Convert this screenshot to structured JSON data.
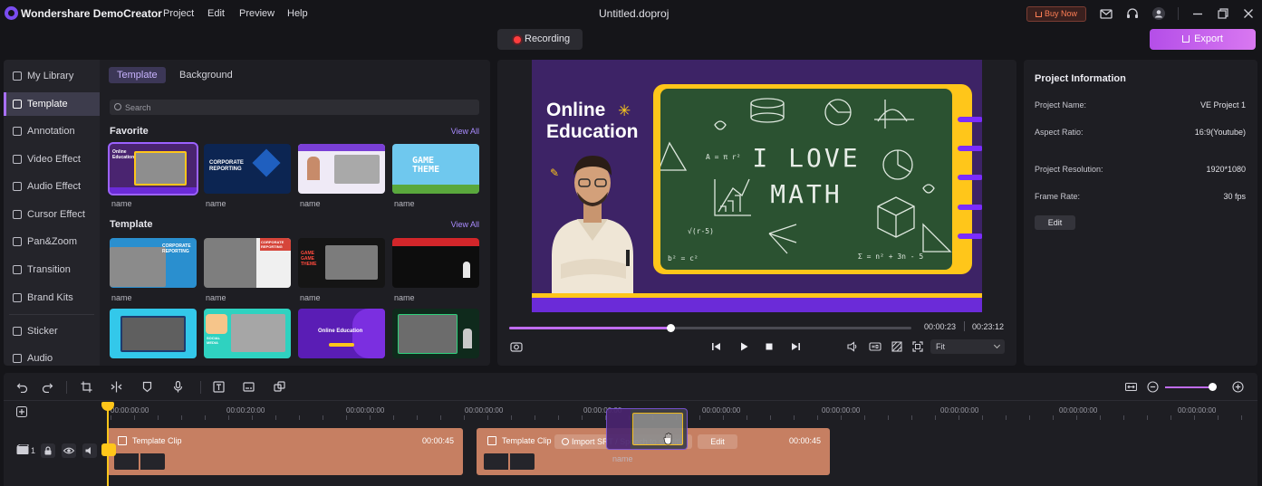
{
  "app": {
    "name": "Wondershare DemoCreator",
    "document_title": "Untitled.doproj",
    "menu": [
      "Project",
      "Edit",
      "Preview",
      "Help"
    ],
    "buy_now": "Buy Now",
    "recording": "Recording",
    "export": "Export"
  },
  "sidebar": {
    "items": [
      {
        "label": "My Library",
        "icon": "library-icon"
      },
      {
        "label": "Template",
        "icon": "template-icon",
        "active": true
      },
      {
        "label": "Annotation",
        "icon": "annotation-icon"
      },
      {
        "label": "Video Effect",
        "icon": "video-effect-icon"
      },
      {
        "label": "Audio Effect",
        "icon": "audio-effect-icon"
      },
      {
        "label": "Cursor Effect",
        "icon": "cursor-effect-icon"
      },
      {
        "label": "Pan&Zoom",
        "icon": "pan-zoom-icon"
      },
      {
        "label": "Transition",
        "icon": "transition-icon"
      },
      {
        "label": "Brand Kits",
        "icon": "brand-kits-icon"
      },
      {
        "label": "Sticker",
        "icon": "sticker-icon"
      },
      {
        "label": "Audio",
        "icon": "audio-icon"
      }
    ]
  },
  "library": {
    "tabs": [
      "Template",
      "Background"
    ],
    "search_placeholder": "Search",
    "favorite": {
      "title": "Favorite",
      "view_all": "View All",
      "items": [
        {
          "name": "name",
          "caption": "Online Education"
        },
        {
          "name": "name",
          "caption": "CORPORATE REPORTING"
        },
        {
          "name": "name",
          "caption": ""
        },
        {
          "name": "name",
          "caption": "GAME THEME"
        }
      ]
    },
    "template": {
      "title": "Template",
      "view_all": "View All",
      "items": [
        {
          "name": "name",
          "caption": "CORPORATE REPORTING"
        },
        {
          "name": "name",
          "caption": "CORPORATE REPORTING"
        },
        {
          "name": "name",
          "caption": "GAME GAME THEME"
        },
        {
          "name": "name",
          "caption": ""
        },
        {
          "name": "",
          "caption": ""
        },
        {
          "name": "",
          "caption": "SOCIAL MEDIA"
        },
        {
          "name": "",
          "caption": "Online Education"
        },
        {
          "name": "",
          "caption": ""
        }
      ]
    }
  },
  "preview": {
    "title_line1": "Online",
    "title_line2": "Education",
    "board_line1": "I LOVE",
    "board_line2": "MATH",
    "formula1": "A = π r²",
    "formula2": "Σ = n² + 3n - 5",
    "formula3": "b² = c²",
    "formula4": "√(r-5)",
    "time_current": "00:00:23",
    "time_total": "00:23:12",
    "progress": 0.4,
    "fit": "Fit"
  },
  "project_info": {
    "title": "Project Information",
    "rows": [
      {
        "label": "Project Name:",
        "value": "VE Project 1"
      },
      {
        "label": "Aspect Ratio:",
        "value": "16:9(Youtube)"
      },
      {
        "label": "Project Resolution:",
        "value": "1920*1080"
      },
      {
        "label": "Frame Rate:",
        "value": "30 fps"
      }
    ],
    "edit": "Edit"
  },
  "timeline": {
    "ruler": [
      "00:00:00:00",
      "00:00:20:00",
      "00:00:00:00",
      "00:00:00:00",
      "00:00:00:00",
      "00:00:00:00",
      "00:00:00:00",
      "00:00:00:00",
      "00:00:00:00",
      "00:00:00:00",
      "00:00:00:00"
    ],
    "track_number": "1",
    "clips": [
      {
        "label": "Template Clip",
        "duration": "00:00:45"
      },
      {
        "label": "Template Clip",
        "duration": "00:00:45",
        "import": "Import SRT / Speech to subtitle",
        "edit": "Edit"
      }
    ],
    "drag_name": "name",
    "zoom": 0.92
  },
  "colors": {
    "accent": "#a970ff",
    "export": "#c862ec",
    "clip": "#c67f62",
    "playhead": "#ffc61a",
    "board": "#2b5231",
    "record": "#ff3d3d"
  }
}
